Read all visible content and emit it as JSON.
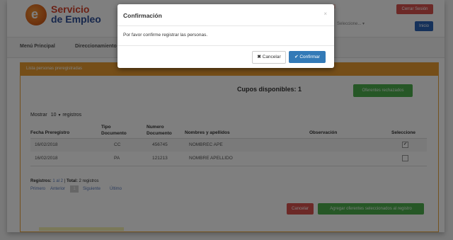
{
  "brand": {
    "logo_letter": "e",
    "line1": "Servicio",
    "line2": "de Empleo"
  },
  "header": {
    "select_placeholder": "Seleccione... ▾",
    "cerrar_sesion": "Cerrar Sesión",
    "inicio": "Inicio"
  },
  "nav": {
    "items": [
      "Menú Principal",
      "Direccionamiento"
    ]
  },
  "panel": {
    "title": "Lista personas preregistradas",
    "cupos": "Cupos disponibles: 1",
    "oferentes_rechazados": "Oferentes rechazados",
    "mostrar": "Mostrar",
    "page_size": "10",
    "registros_label": "registros"
  },
  "table": {
    "headers": [
      "Fecha Preregistro",
      "Tipo Documento",
      "Numero Documento",
      "Nombres y apellidos",
      "Observación",
      "Seleccione"
    ],
    "rows": [
      {
        "fecha": "16/02/2018",
        "tipo": "CC",
        "numero": "456745",
        "nombre": "NOMBREC APE",
        "observacion": "",
        "checked": true
      },
      {
        "fecha": "16/02/2018",
        "tipo": "PA",
        "numero": "121213",
        "nombre": "NOMBRE APELLIDO",
        "observacion": "",
        "checked": false
      }
    ]
  },
  "footer": {
    "registros_label": "Registros:",
    "registros_range": "1 al 2",
    "total_label": "Total:",
    "total_value": "2 registros",
    "pager": [
      "Primero",
      "Anterior",
      "1",
      "Siguiente",
      "Último"
    ],
    "cancelar": "Cancelar",
    "agregar": "Agregar oferentes seleccionados al registro"
  },
  "modal": {
    "title": "Confirmación",
    "close": "×",
    "message": "Por favor confirme registrar las personas.",
    "cancel_label": "Cancelar",
    "confirm_label": "Confirmar"
  },
  "colors": {
    "panel_header": "#ea9d30",
    "primary": "#337ab7",
    "danger": "#d9534f",
    "success": "#4cae4c"
  }
}
